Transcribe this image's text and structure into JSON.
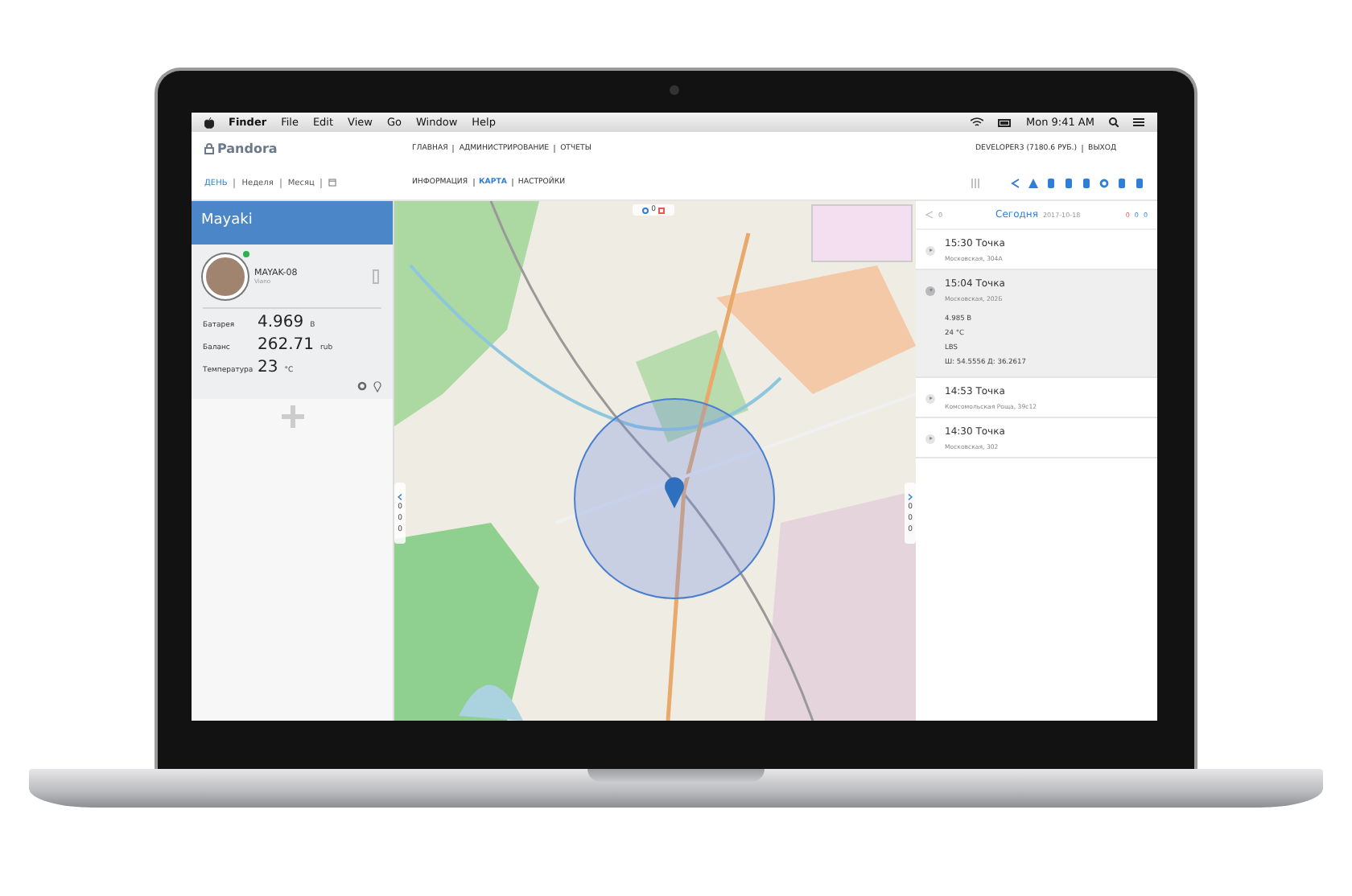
{
  "menubar": {
    "app": "Finder",
    "items": [
      "File",
      "Edit",
      "View",
      "Go",
      "Window",
      "Help"
    ],
    "clock": "Mon 9:41 AM"
  },
  "header": {
    "logo": "Pandora",
    "nav": [
      "ГЛАВНАЯ",
      "АДМИНИСТРИРОВАНИЕ",
      "ОТЧЕТЫ"
    ],
    "account": "DEVELOPER3 (7180.6 РУБ.)",
    "logout": "ВЫХОД"
  },
  "period_tabs": [
    {
      "label": "ДЕНЬ",
      "selected": true
    },
    {
      "label": "Неделя",
      "selected": false
    },
    {
      "label": "Месяц",
      "selected": false
    }
  ],
  "view_tabs": [
    {
      "label": "ИНФОРМАЦИЯ",
      "selected": false
    },
    {
      "label": "КАРТА",
      "selected": true
    },
    {
      "label": "НАСТРОЙКИ",
      "selected": false
    }
  ],
  "sidebar": {
    "title": "Mayaki",
    "device": {
      "name": "MAYAK-08",
      "subtitle": "Viano",
      "online": true
    },
    "stats": [
      {
        "label": "Батарея",
        "value": "4.969",
        "unit": "В"
      },
      {
        "label": "Баланс",
        "value": "262.71",
        "unit": "rub"
      },
      {
        "label": "Температура",
        "value": "23",
        "unit": "°C"
      }
    ]
  },
  "map": {
    "top_count": "0",
    "left_counts": [
      "0",
      "0",
      "0"
    ],
    "right_counts": [
      "0",
      "0",
      "0"
    ]
  },
  "timeline": {
    "share_count": "0",
    "title": "Сегодня",
    "date": "2017-10-18",
    "counters": [
      "0",
      "0",
      "0"
    ],
    "events": [
      {
        "time": "15:30",
        "type": "Точка",
        "address": "Московская, 304А",
        "expanded": false
      },
      {
        "time": "15:04",
        "type": "Точка",
        "address": "Московская, 202Б",
        "expanded": true,
        "details": [
          "4.985 В",
          "24 °C",
          "LBS",
          "Ш: 54.5556 Д: 36.2617"
        ]
      },
      {
        "time": "14:53",
        "type": "Точка",
        "address": "Комсомольская Роща, 39с12",
        "expanded": false
      },
      {
        "time": "14:30",
        "type": "Точка",
        "address": "Московская, 302",
        "expanded": false
      }
    ]
  }
}
